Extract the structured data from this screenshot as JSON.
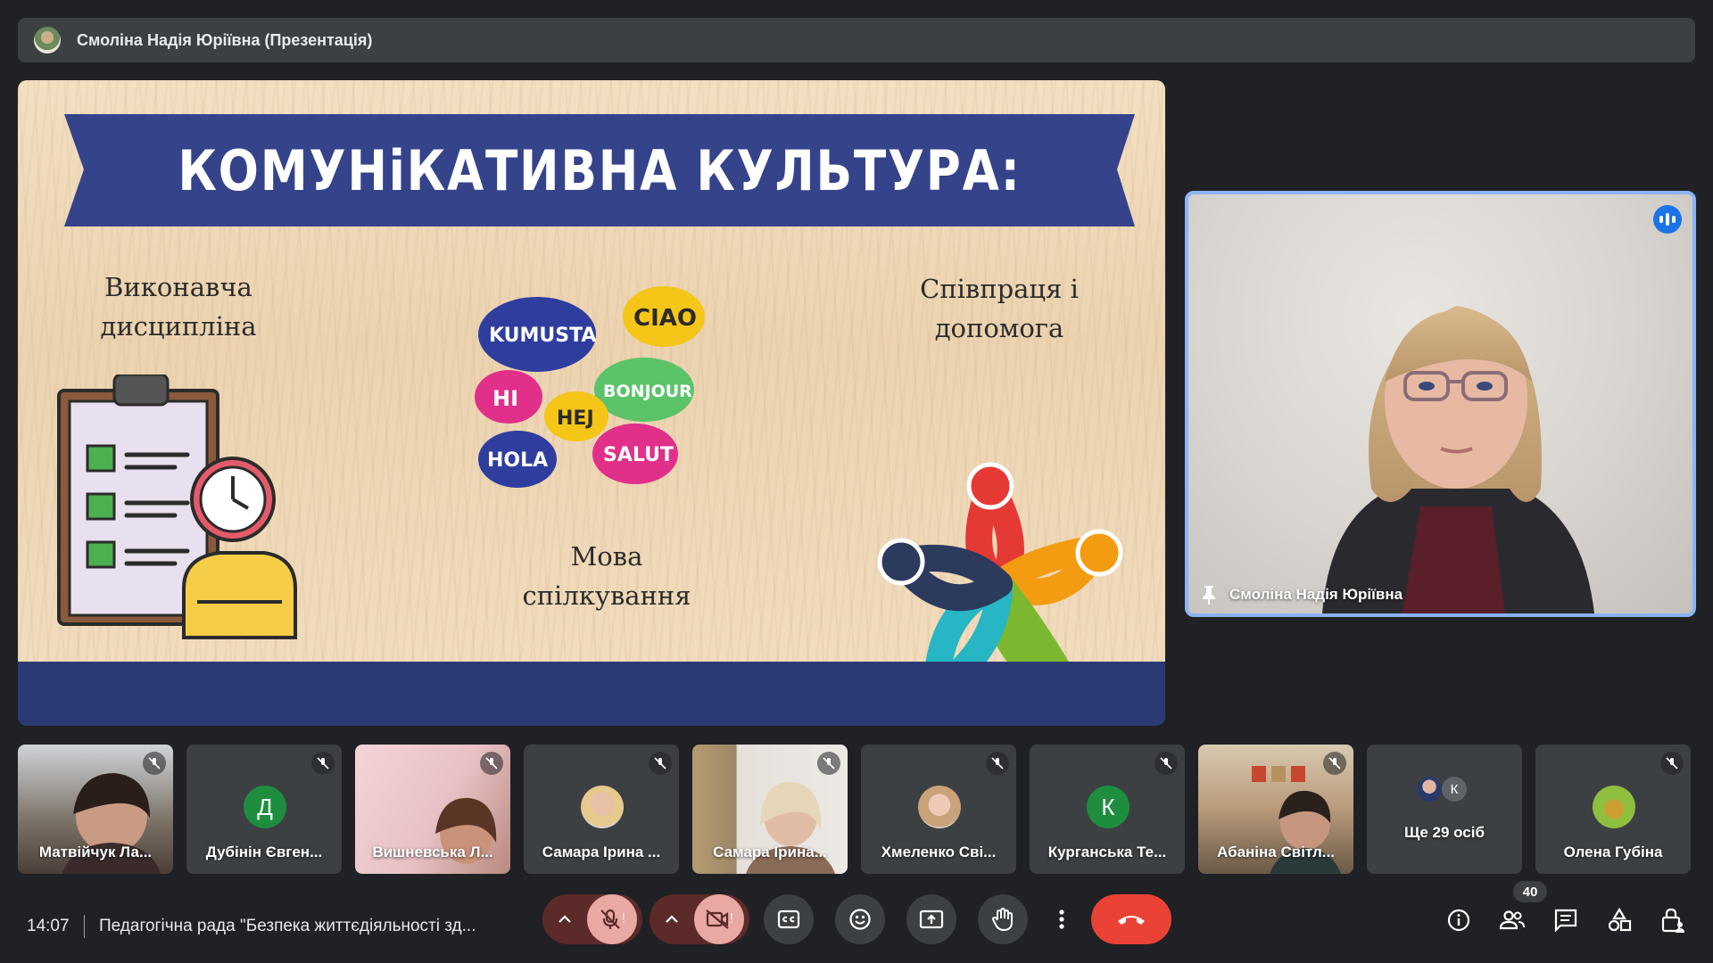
{
  "presenter_bar": {
    "title": "Смоліна Надія Юріївна (Презентація)"
  },
  "slide": {
    "heading": "КОМУНіКАТИВНА КУЛЬТУРА:",
    "label_left": [
      "Виконавча",
      "дисципліна"
    ],
    "label_center": [
      "Мова",
      "спілкування"
    ],
    "label_right": [
      "Співпраця і",
      "допомога"
    ],
    "bubbles": [
      "KUMUSTA",
      "CIAO",
      "HI",
      "BONJOUR",
      "HEJ",
      "HOLA",
      "SALUT"
    ]
  },
  "speaker": {
    "name": "Смоліна Надія Юріївна",
    "pin_icon": "pin-icon",
    "status_icon": "speaking-indicator-icon"
  },
  "participants": [
    {
      "name": "Матвійчук Ла...",
      "type": "camera",
      "muted": true
    },
    {
      "name": "Дубінін Євген...",
      "type": "letter",
      "letter": "Д",
      "color": "#1e8e3e",
      "muted": true
    },
    {
      "name": "Вишневська Л...",
      "type": "camera",
      "muted": true
    },
    {
      "name": "Самара Ірина ...",
      "type": "photo",
      "muted": true
    },
    {
      "name": "Самара Ірина...",
      "type": "camera",
      "muted": true
    },
    {
      "name": "Хмеленко Сві...",
      "type": "photo",
      "muted": true
    },
    {
      "name": "Курганська Те...",
      "type": "letter",
      "letter": "К",
      "color": "#1e8e3e",
      "muted": true
    },
    {
      "name": "Абаніна Світл...",
      "type": "camera",
      "muted": true
    },
    {
      "name": "Ще 29 осіб",
      "type": "overflow",
      "letter": "К"
    },
    {
      "name": "Олена Губіна",
      "type": "photo",
      "muted": true
    }
  ],
  "bottom_bar": {
    "time": "14:07",
    "meeting_title": "Педагогічна рада \"Безпека життєдіяльності зд...",
    "participants_count": "40",
    "warning_mark": "!"
  },
  "colors": {
    "background": "#202124",
    "tile": "#3c4043",
    "end_call": "#ea4335",
    "mic_off": "#f28b82",
    "accent": "#8ab4f8",
    "banner": "#34438a"
  }
}
